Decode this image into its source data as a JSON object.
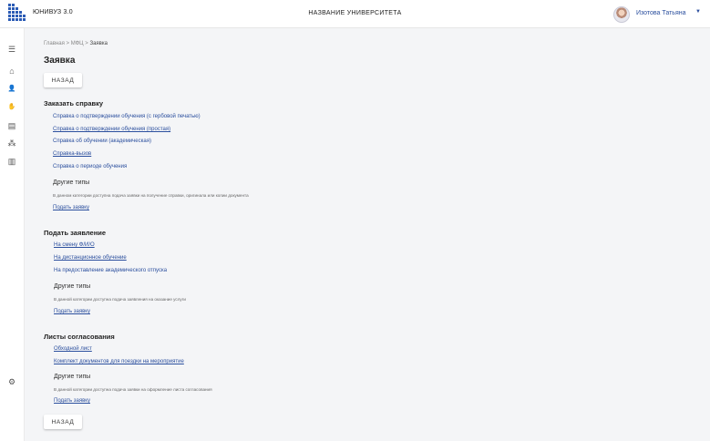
{
  "header": {
    "app_name": "ЮНИВУЗ 3.0",
    "university_name": "НАЗВАНИЕ УНИВЕРСИТЕТА",
    "user_name": "Изотова Татьяна",
    "user_menu_caret": "▼"
  },
  "sidebar": {
    "items": [
      {
        "icon": "menu-icon",
        "glyph": "☰"
      },
      {
        "icon": "home-icon",
        "glyph": "⌂"
      },
      {
        "icon": "person-icon",
        "glyph": "👤"
      },
      {
        "icon": "handshake-icon",
        "glyph": "✋"
      },
      {
        "icon": "document-icon",
        "glyph": "▤"
      },
      {
        "icon": "network-icon",
        "glyph": "⁂"
      },
      {
        "icon": "chart-icon",
        "glyph": "▥"
      },
      {
        "icon": "settings-icon",
        "glyph": "⚙"
      }
    ]
  },
  "breadcrumb": {
    "home": "Главная",
    "sep1": " > ",
    "mfc": "МФЦ",
    "sep2": " > ",
    "current": "Заявка"
  },
  "page_title": "Заявка",
  "back_button": "НАЗАД",
  "section_certificates": {
    "title": "Заказать справку",
    "links": [
      "Справка о подтверждении обучения (с гербовой печатью)",
      "Справка о подтверждении обучения (простая)",
      "Справка об обучении (академическая)",
      "Справка-вызов",
      "Справка о периоде обучения"
    ],
    "other_title": "Другие типы",
    "other_note": "В данном категории доступна подача заявки на получение справки, оригинала или копии документа",
    "other_link": "Подать заявку"
  },
  "section_applications": {
    "title": "Подать заявление",
    "links": [
      "На смену Ф/И/О",
      "На дистанционное обучение",
      "На предоставление академического отпуска"
    ],
    "other_title": "Другие типы",
    "other_note": "В данной категории доступна подача заявления на оказание услуги",
    "other_link": "Подать заявку"
  },
  "section_approvals": {
    "title": "Листы согласования",
    "links": [
      "Обходной лист",
      "Комплект документов для поездки на мероприятие"
    ],
    "other_title": "Другие типы",
    "other_note": "В данной категории доступна подача заявки на оформление листа согласования",
    "other_link": "Подать заявку"
  }
}
